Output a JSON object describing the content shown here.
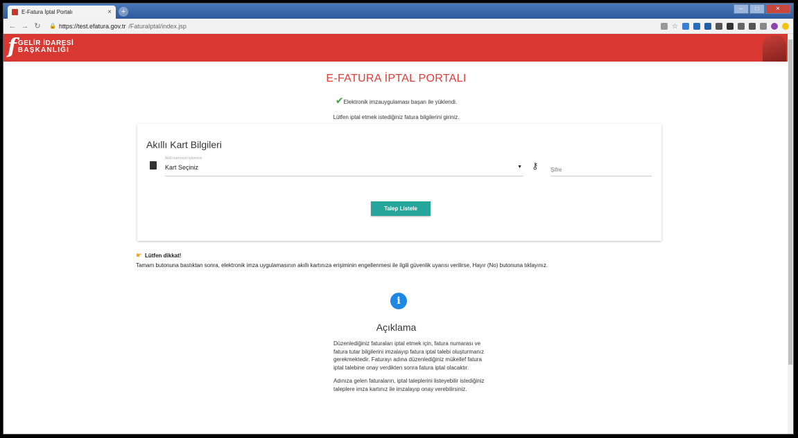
{
  "browser": {
    "tab_title": "E-Fatura İptal Portalı",
    "tab_close": "×",
    "new_tab": "+",
    "url_host": "https://test.efatura.gov.tr",
    "url_path": "/FaturaIptal/index.jsp"
  },
  "header": {
    "logo_line1": "GELİR İDARESİ",
    "logo_line2": "BAŞKANLIĞI",
    "brand_color": "#d83831"
  },
  "page": {
    "title": "E-FATURA İPTAL PORTALI",
    "status": "Elektronik imzauygulaması başarı ile yüklendi.",
    "instruction": "Lütfen iptal etmek istediğiniz fatura bilgilerini giriniz."
  },
  "card": {
    "title": "Akıllı Kart Bilgileri",
    "select_label": "Akıllı kartınızın işlemcisi",
    "select_value": "Kart Seçiniz",
    "password_placeholder": "Şifre",
    "button_label": "Talep Listele",
    "button_color": "#26a69a"
  },
  "warning": {
    "title": "Lütfen dikkat!",
    "text": "Tamam butonuna bastıktan sonra, elektronik imza uygulamasının akıllı kartınıza erişiminin engellenmesi ile ilgili güvenlik uyarısı verilirse, Hayır (No) butonuna tıklayınız."
  },
  "aciklama": {
    "title": "Açıklama",
    "para1": "Düzenlediğiniz faturaları iptal etmek için, fatura numarası ve fatura tutar bilgilerini imzalayıp fatura iptal talebi oluşturmanız gerekmektedir. Faturayı adına düzenlediğiniz mükellef fatura iptal talebine onay verdikten sonra fatura iptal olacaktır.",
    "para2": "Adınıza gelen faturaların, iptal taleplerini listeyebilir istediğiniz taleplere imza kartınız ile imzalayıp onay verebilirsiniz."
  }
}
